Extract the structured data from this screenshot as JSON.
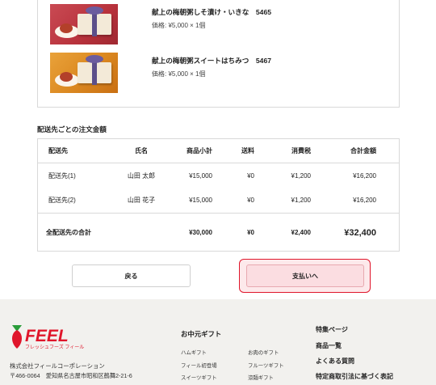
{
  "items": [
    {
      "name": "献上の梅朝粥しそ漬け・いきな　5465",
      "price": "価格: ¥5,000 × 1個"
    },
    {
      "name": "献上の梅朝粥スイートはちみつ　5467",
      "price": "価格: ¥5,000 × 1個"
    }
  ],
  "summary_title": "配送先ごとの注文金額",
  "table": {
    "headers": [
      "配送先",
      "氏名",
      "商品小計",
      "送料",
      "消費税",
      "合計金額"
    ],
    "rows": [
      [
        "配送先(1)",
        "山田 太郎",
        "¥15,000",
        "¥0",
        "¥1,200",
        "¥16,200"
      ],
      [
        "配送先(2)",
        "山田 花子",
        "¥15,000",
        "¥0",
        "¥1,200",
        "¥16,200"
      ]
    ],
    "total": {
      "label": "全配送先の合計",
      "subtotal": "¥30,000",
      "shipping": "¥0",
      "tax": "¥2,400",
      "grand": "¥32,400"
    }
  },
  "buttons": {
    "back": "戻る",
    "pay": "支払いへ"
  },
  "footer": {
    "logo_text": "FEEL",
    "logo_sub": "フレッシュフーズ フィール",
    "company": "株式会社フィールコーポレーション",
    "address": "〒466-0064　愛知県名古屋市昭和区鶴舞2-21-6",
    "gift_heading": "お中元ギフト",
    "gift_links": [
      "ハムギフト",
      "お肉のギフト",
      "フィール初登場",
      "フルーツギフト",
      "スイーツギフト",
      "涼麺ギフト"
    ],
    "right_links": [
      "特集ページ",
      "商品一覧",
      "よくある質問",
      "特定商取引法に基づく表記"
    ]
  },
  "colors": {
    "brand_red": "#e0162b",
    "brand_green": "#2a9d3a",
    "footer_bg": "#f2f1ee"
  }
}
